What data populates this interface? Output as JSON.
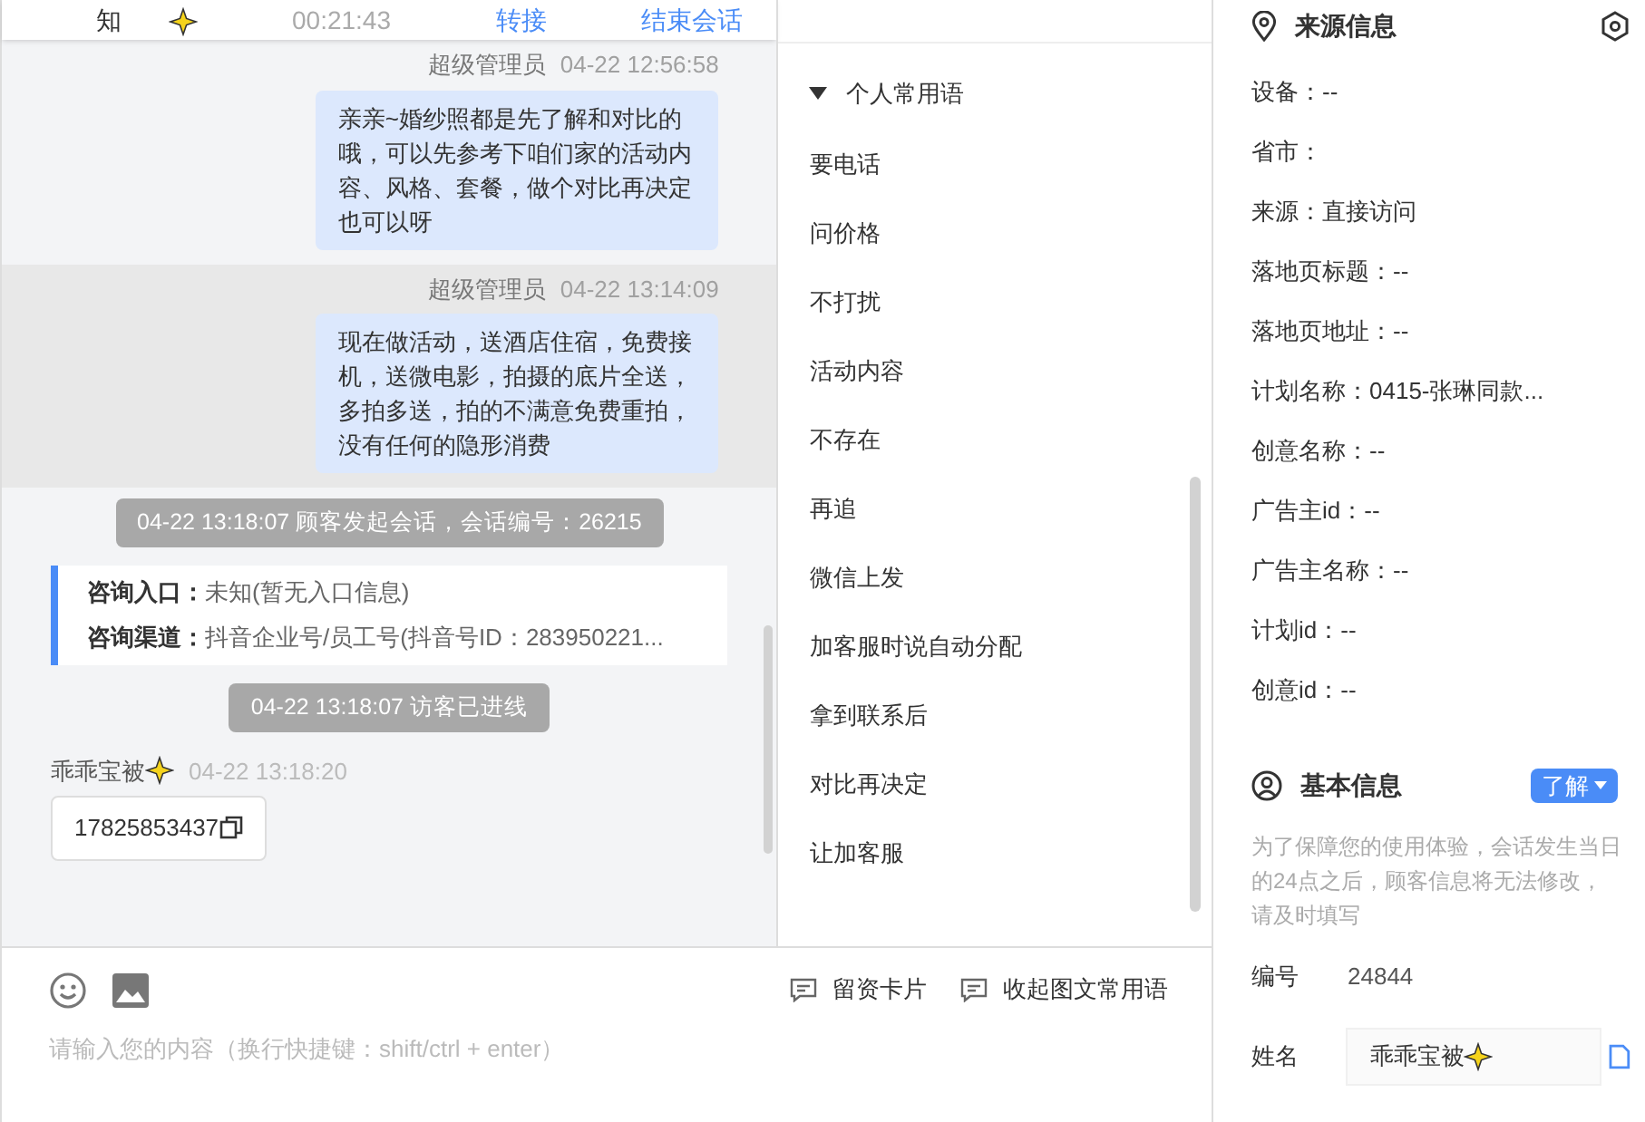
{
  "header": {
    "name": "知",
    "duration": "00:21:43",
    "actions": [
      "转接",
      "结束会话"
    ]
  },
  "messages": [
    {
      "kind": "agent",
      "sender": "超级管理员",
      "time": "04-22 12:56:58",
      "text": "亲亲~婚纱照都是先了解和对比的哦，可以先参考下咱们家的活动内容、风格、套餐，做个对比再决定也可以呀",
      "highlighted": false
    },
    {
      "kind": "agent",
      "sender": "超级管理员",
      "time": "04-22 13:14:09",
      "text": "现在做活动，送酒店住宿，免费接机，送微电影，拍摄的底片全送，多拍多送，拍的不满意免费重拍，没有任何的隐形消费",
      "highlighted": true
    },
    {
      "kind": "system",
      "text": "04-22 13:18:07 顾客发起会话，会话编号：26215"
    },
    {
      "kind": "entry",
      "rows": [
        {
          "label": "咨询入口：",
          "value": "未知(暂无入口信息)"
        },
        {
          "label": "咨询渠道：",
          "value": "抖音企业号/员工号(抖音号ID：283950221..."
        }
      ]
    },
    {
      "kind": "system",
      "text": "04-22 13:18:07 访客已进线"
    },
    {
      "kind": "visitor",
      "sender": "乖乖宝被",
      "time": "04-22 13:18:20",
      "text": "17825853437"
    }
  ],
  "phrases": {
    "group": "个人常用语",
    "expanded": true,
    "items": [
      "要电话",
      "问价格",
      "不打扰",
      "活动内容",
      "不存在",
      "再追",
      "微信上发",
      "加客服时说自动分配",
      "拿到联系后",
      "对比再决定",
      "让加客服"
    ]
  },
  "toolbar": [
    "留资卡片",
    "收起图文常用语"
  ],
  "input": {
    "placeholder": "请输入您的内容（换行快捷键：shift/ctrl + enter）"
  },
  "source": {
    "title": "来源信息",
    "fields": [
      "设备：--",
      "省市：",
      "来源：直接访问",
      "落地页标题：--",
      "落地页地址：--",
      "计划名称：0415-张琳同款...",
      "创意名称：--",
      "广告主id：--",
      "广告主名称：--",
      "计划id：--",
      "创意id：--"
    ]
  },
  "basic": {
    "title": "基本信息",
    "button": "了解",
    "notice": "为了保障您的使用体验，会话发生当日的24点之后，顾客信息将无法修改，请及时填写",
    "fields": [
      {
        "kind": "text",
        "label": "编号",
        "value": "24844"
      },
      {
        "kind": "input",
        "label": "姓名",
        "value": "乖乖宝被"
      }
    ]
  }
}
